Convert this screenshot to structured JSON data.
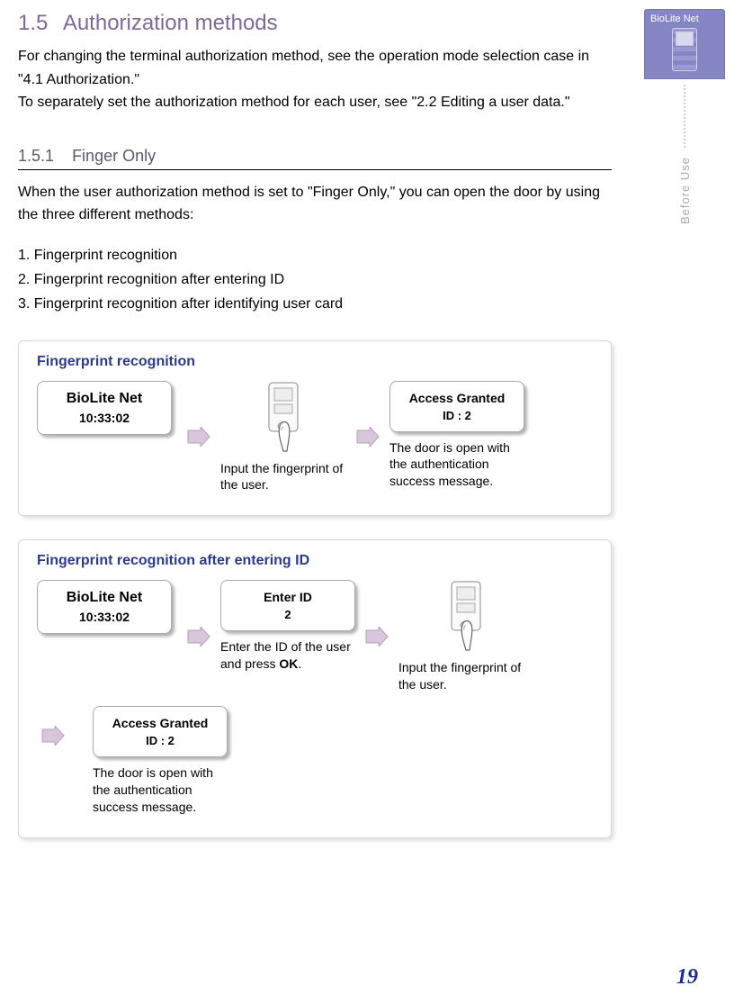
{
  "section": {
    "num": "1.5",
    "title": "Authorization methods"
  },
  "intro1": "For changing the terminal authorization method, see the operation mode selection case in \"4.1 Authorization.\"",
  "intro2": "To separately set the authorization method for each user, see \"2.2 Editing a user data.\"",
  "subsection": {
    "num": "1.5.1",
    "title": "Finger Only"
  },
  "sub_intro": "When the user authorization method is set to \"Finger Only,\" you can open the door by using the three different methods:",
  "list": [
    "1. Fingerprint recognition",
    "2. Fingerprint recognition after entering ID",
    "3. Fingerprint recognition after identifying user card"
  ],
  "panel1": {
    "title": "Fingerprint recognition",
    "start_box": {
      "line1": "BioLite Net",
      "line2": "10:33:02"
    },
    "step2_caption": "Input the fingerprint of the user.",
    "result_box": {
      "line1": "Access Granted",
      "line2": "ID : 2"
    },
    "step3_caption": "The door is open with the authentication success message."
  },
  "panel2": {
    "title": "Fingerprint recognition after entering ID",
    "start_box": {
      "line1": "BioLite Net",
      "line2": "10:33:02"
    },
    "id_box": {
      "line1": "Enter ID",
      "line2": "2"
    },
    "step2_caption_pre": "Enter the ID of the user and press ",
    "step2_caption_bold": "OK",
    "step2_caption_post": ".",
    "step3_caption": "Input the fingerprint of the user.",
    "result_box": {
      "line1": "Access Granted",
      "line2": "ID : 2"
    },
    "result_caption": "The door is open with the authentication success message."
  },
  "side": {
    "brand": "BioLite Net",
    "label": "Before  Use"
  },
  "pagenum": "19"
}
